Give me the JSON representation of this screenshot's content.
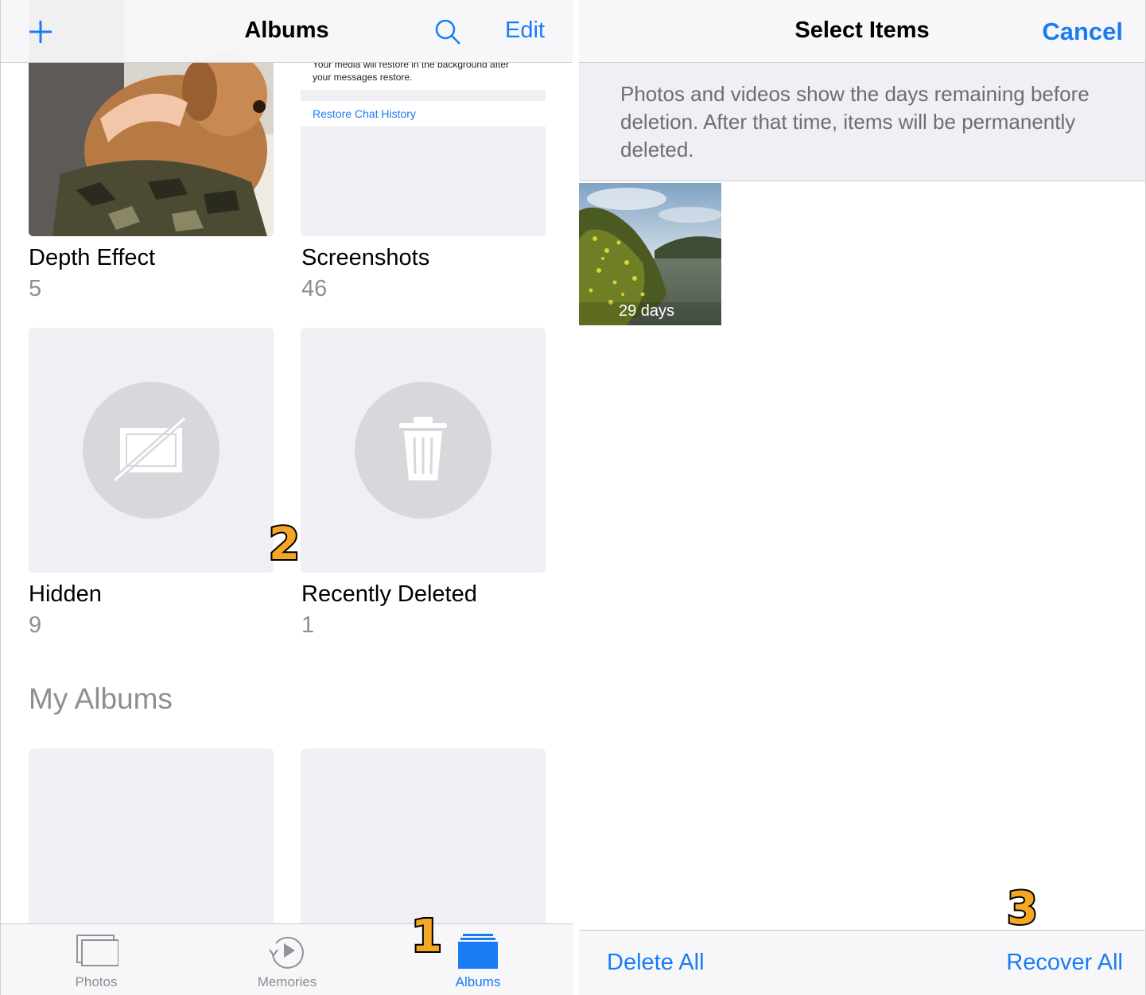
{
  "left": {
    "nav": {
      "title": "Albums",
      "edit_label": "Edit"
    },
    "albums": [
      {
        "title": "Depth Effect",
        "count": "5"
      },
      {
        "title": "Screenshots",
        "count": "46"
      },
      {
        "title": "Hidden",
        "count": "9"
      },
      {
        "title": "Recently Deleted",
        "count": "1"
      }
    ],
    "screenshot_preview": {
      "line1": "Your media will restore in the background after",
      "line2": "your messages restore.",
      "link": "Restore Chat History"
    },
    "my_albums_title": "My Albums",
    "tabs": [
      {
        "label": "Photos",
        "icon": "photos-tab-icon",
        "active": false
      },
      {
        "label": "Memories",
        "icon": "memories-tab-icon",
        "active": false
      },
      {
        "label": "Albums",
        "icon": "albums-tab-icon",
        "active": true
      }
    ]
  },
  "right": {
    "nav": {
      "title": "Select Items",
      "cancel_label": "Cancel"
    },
    "info": "Photos and videos show the days remaining before deletion. After that time, items will be permanently deleted.",
    "photo": {
      "days_remaining": "29 days"
    },
    "toolbar": {
      "delete_all": "Delete All",
      "recover_all": "Recover All"
    }
  },
  "steps": [
    "1",
    "2",
    "3"
  ],
  "colors": {
    "accent": "#1a7cf5",
    "step_marker": "#f5a623",
    "inactive": "#8e8e93"
  }
}
